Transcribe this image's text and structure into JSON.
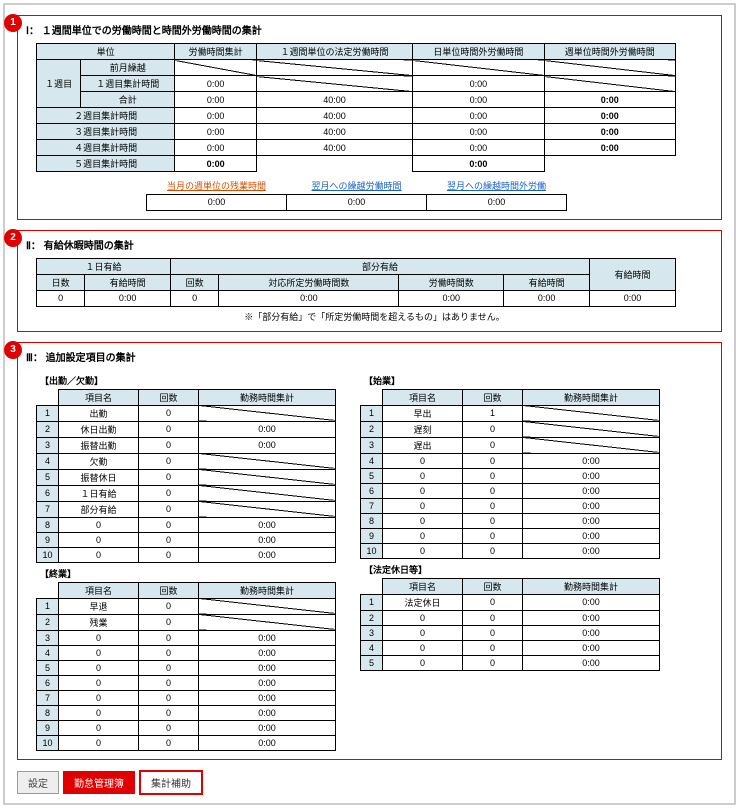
{
  "circles": [
    "1",
    "2",
    "3"
  ],
  "sec1": {
    "title": "Ⅰ： １週間単位での労働時間と時間外労働時間の集計",
    "headers": [
      "単位",
      "労働時間集計",
      "１週間単位の法定労働時間",
      "日単位時間外労働時間",
      "週単位時間外労働時間"
    ],
    "week1_label": "１週目",
    "rows_w1": [
      {
        "label": "前月繰越",
        "c2": "",
        "c3": "",
        "c4": "",
        "c5": "",
        "diag": [
          2,
          3,
          4,
          5
        ]
      },
      {
        "label": "１週目集計時間",
        "c2": "0:00",
        "c3": "",
        "c4": "0:00",
        "c5": "",
        "diag": [
          3,
          5
        ]
      },
      {
        "label": "合計",
        "c2": "0:00",
        "c3": "40:00",
        "c4": "0:00",
        "c5": "0:00",
        "bold": [
          5
        ]
      }
    ],
    "rows_rest": [
      {
        "label": "２週目集計時間",
        "c2": "0:00",
        "c3": "40:00",
        "c4": "0:00",
        "c5": "0:00",
        "bold": [
          5
        ]
      },
      {
        "label": "３週目集計時間",
        "c2": "0:00",
        "c3": "40:00",
        "c4": "0:00",
        "c5": "0:00",
        "bold": [
          5
        ]
      },
      {
        "label": "４週目集計時間",
        "c2": "0:00",
        "c3": "40:00",
        "c4": "0:00",
        "c5": "0:00",
        "bold": [
          5
        ]
      },
      {
        "label": "５週目集計時間",
        "c2": "0:00",
        "c3": "",
        "c4": "0:00",
        "c5": "",
        "bold": [
          2,
          4
        ],
        "noborder": [
          3,
          5
        ]
      }
    ],
    "sub_headers": [
      {
        "text": "当月の週単位の残業時間",
        "cls": "link-red"
      },
      {
        "text": "翌月への繰越労働時間",
        "cls": "link-cell"
      },
      {
        "text": "翌月への繰越時間外労働",
        "cls": "link-cell"
      }
    ],
    "sub_vals": [
      "0:00",
      "0:00",
      "0:00"
    ]
  },
  "sec2": {
    "title": "Ⅱ： 有給休暇時間の集計",
    "top": [
      "１日有給",
      "部分有給",
      "有給時間"
    ],
    "mid": [
      "日数",
      "有給時間",
      "回数",
      "対応所定労働時間数",
      "労働時間数",
      "有給時間"
    ],
    "vals": [
      "0",
      "0:00",
      "0",
      "0:00",
      "0:00",
      "0:00",
      "0:00"
    ],
    "note": "※「部分有給」で「所定労働時間を超えるもの」はありません。"
  },
  "sec3": {
    "title": "Ⅲ： 追加設定項目の集計",
    "hdr": [
      "項目名",
      "回数",
      "勤務時間集計"
    ],
    "group1": {
      "label": "【出勤／欠勤】",
      "rows": [
        {
          "n": "1",
          "name": "出勤",
          "cnt": "0",
          "time": "",
          "diag": true
        },
        {
          "n": "2",
          "name": "休日出勤",
          "cnt": "0",
          "time": "0:00"
        },
        {
          "n": "3",
          "name": "振替出勤",
          "cnt": "0",
          "time": "0:00"
        },
        {
          "n": "4",
          "name": "欠勤",
          "cnt": "0",
          "time": "",
          "diag": true
        },
        {
          "n": "5",
          "name": "振替休日",
          "cnt": "0",
          "time": "",
          "diag": true
        },
        {
          "n": "6",
          "name": "１日有給",
          "cnt": "0",
          "time": "",
          "diag": true
        },
        {
          "n": "7",
          "name": "部分有給",
          "cnt": "0",
          "time": "",
          "diag": true
        },
        {
          "n": "8",
          "name": "0",
          "cnt": "0",
          "time": "0:00"
        },
        {
          "n": "9",
          "name": "0",
          "cnt": "0",
          "time": "0:00"
        },
        {
          "n": "10",
          "name": "0",
          "cnt": "0",
          "time": "0:00"
        }
      ]
    },
    "group2": {
      "label": "【始業】",
      "rows": [
        {
          "n": "1",
          "name": "早出",
          "cnt": "1",
          "time": "",
          "diag": true
        },
        {
          "n": "2",
          "name": "遅刻",
          "cnt": "0",
          "time": "",
          "diag": true
        },
        {
          "n": "3",
          "name": "遅出",
          "cnt": "0",
          "time": "",
          "diag": true
        },
        {
          "n": "4",
          "name": "0",
          "cnt": "0",
          "time": "0:00"
        },
        {
          "n": "5",
          "name": "0",
          "cnt": "0",
          "time": "0:00"
        },
        {
          "n": "6",
          "name": "0",
          "cnt": "0",
          "time": "0:00"
        },
        {
          "n": "7",
          "name": "0",
          "cnt": "0",
          "time": "0:00"
        },
        {
          "n": "8",
          "name": "0",
          "cnt": "0",
          "time": "0:00"
        },
        {
          "n": "9",
          "name": "0",
          "cnt": "0",
          "time": "0:00"
        },
        {
          "n": "10",
          "name": "0",
          "cnt": "0",
          "time": "0:00"
        }
      ]
    },
    "group3": {
      "label": "【終業】",
      "rows": [
        {
          "n": "1",
          "name": "早退",
          "cnt": "0",
          "time": "",
          "diag": true
        },
        {
          "n": "2",
          "name": "残業",
          "cnt": "0",
          "time": "",
          "diag": true
        },
        {
          "n": "3",
          "name": "0",
          "cnt": "0",
          "time": "0:00"
        },
        {
          "n": "4",
          "name": "0",
          "cnt": "0",
          "time": "0:00"
        },
        {
          "n": "5",
          "name": "0",
          "cnt": "0",
          "time": "0:00"
        },
        {
          "n": "6",
          "name": "0",
          "cnt": "0",
          "time": "0:00"
        },
        {
          "n": "7",
          "name": "0",
          "cnt": "0",
          "time": "0:00"
        },
        {
          "n": "8",
          "name": "0",
          "cnt": "0",
          "time": "0:00"
        },
        {
          "n": "9",
          "name": "0",
          "cnt": "0",
          "time": "0:00"
        },
        {
          "n": "10",
          "name": "0",
          "cnt": "0",
          "time": "0:00"
        }
      ]
    },
    "group4": {
      "label": "【法定休日等】",
      "rows": [
        {
          "n": "1",
          "name": "法定休日",
          "cnt": "0",
          "time": "0:00"
        },
        {
          "n": "2",
          "name": "0",
          "cnt": "0",
          "time": "0:00"
        },
        {
          "n": "3",
          "name": "0",
          "cnt": "0",
          "time": "0:00"
        },
        {
          "n": "4",
          "name": "0",
          "cnt": "0",
          "time": "0:00"
        },
        {
          "n": "5",
          "name": "0",
          "cnt": "0",
          "time": "0:00"
        }
      ]
    }
  },
  "tabs": {
    "settings": "設定",
    "roster": "勤怠管理簿",
    "aux": "集計補助"
  }
}
